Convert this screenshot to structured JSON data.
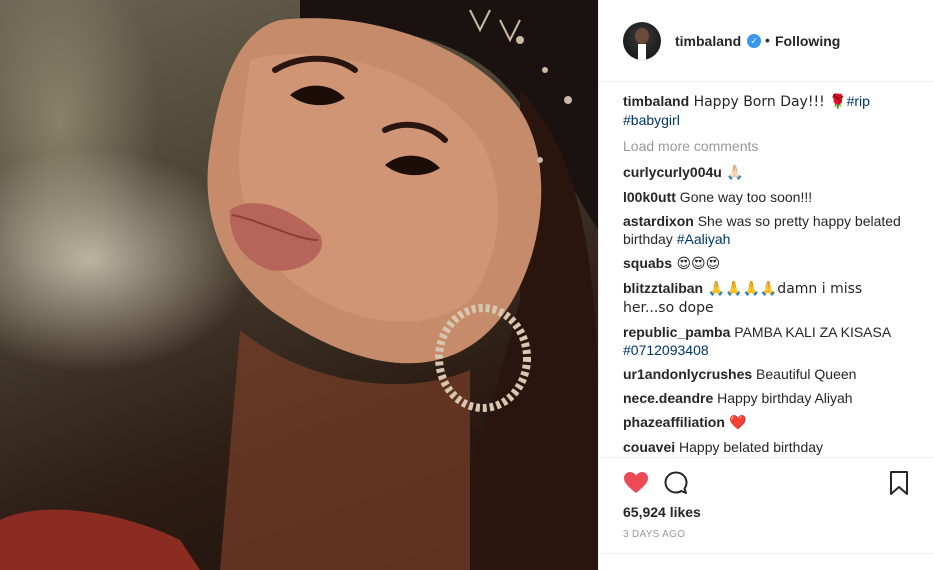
{
  "post": {
    "username": "timbaland",
    "verified_mark": "✓",
    "separator": "•",
    "follow_status": "Following",
    "caption": {
      "user": "timbaland",
      "text": " Happy Born Day!!! 🌹",
      "tags": [
        "#rip",
        "#babygirl"
      ]
    },
    "load_more": "Load more comments",
    "comments": [
      {
        "user": "curlycurly004u",
        "text": " 🙏🏻"
      },
      {
        "user": "l00k0utt",
        "text": " Gone way too soon!!!"
      },
      {
        "user": "astardixon",
        "text": " She was so pretty happy belated birthday ",
        "tag": "#Aaliyah"
      },
      {
        "user": "squabs",
        "text": " 😍😍😍"
      },
      {
        "user": "blitzztaliban",
        "text": " 🙏🙏🙏🙏damn i miss her...so dope"
      },
      {
        "user": "republic_pamba",
        "text": " PAMBA KALI ZA KISASA ",
        "tag": "#0712093408"
      },
      {
        "user": "ur1andonlycrushes",
        "text": " Beautiful Queen"
      },
      {
        "user": "nece.deandre",
        "text": " Happy birthday Aliyah"
      },
      {
        "user": "phazeaffiliation",
        "text": " ❤️"
      },
      {
        "user": "couavei",
        "text": " Happy belated birthday"
      }
    ],
    "likes": "65,924 likes",
    "date": "3 DAYS AGO",
    "icons": {
      "like": "heart-icon",
      "comment": "comment-bubble-icon",
      "save": "bookmark-icon"
    },
    "colors": {
      "heart": "#ed4956",
      "verified": "#3897f0",
      "tag": "#003569",
      "muted": "#999999"
    }
  }
}
